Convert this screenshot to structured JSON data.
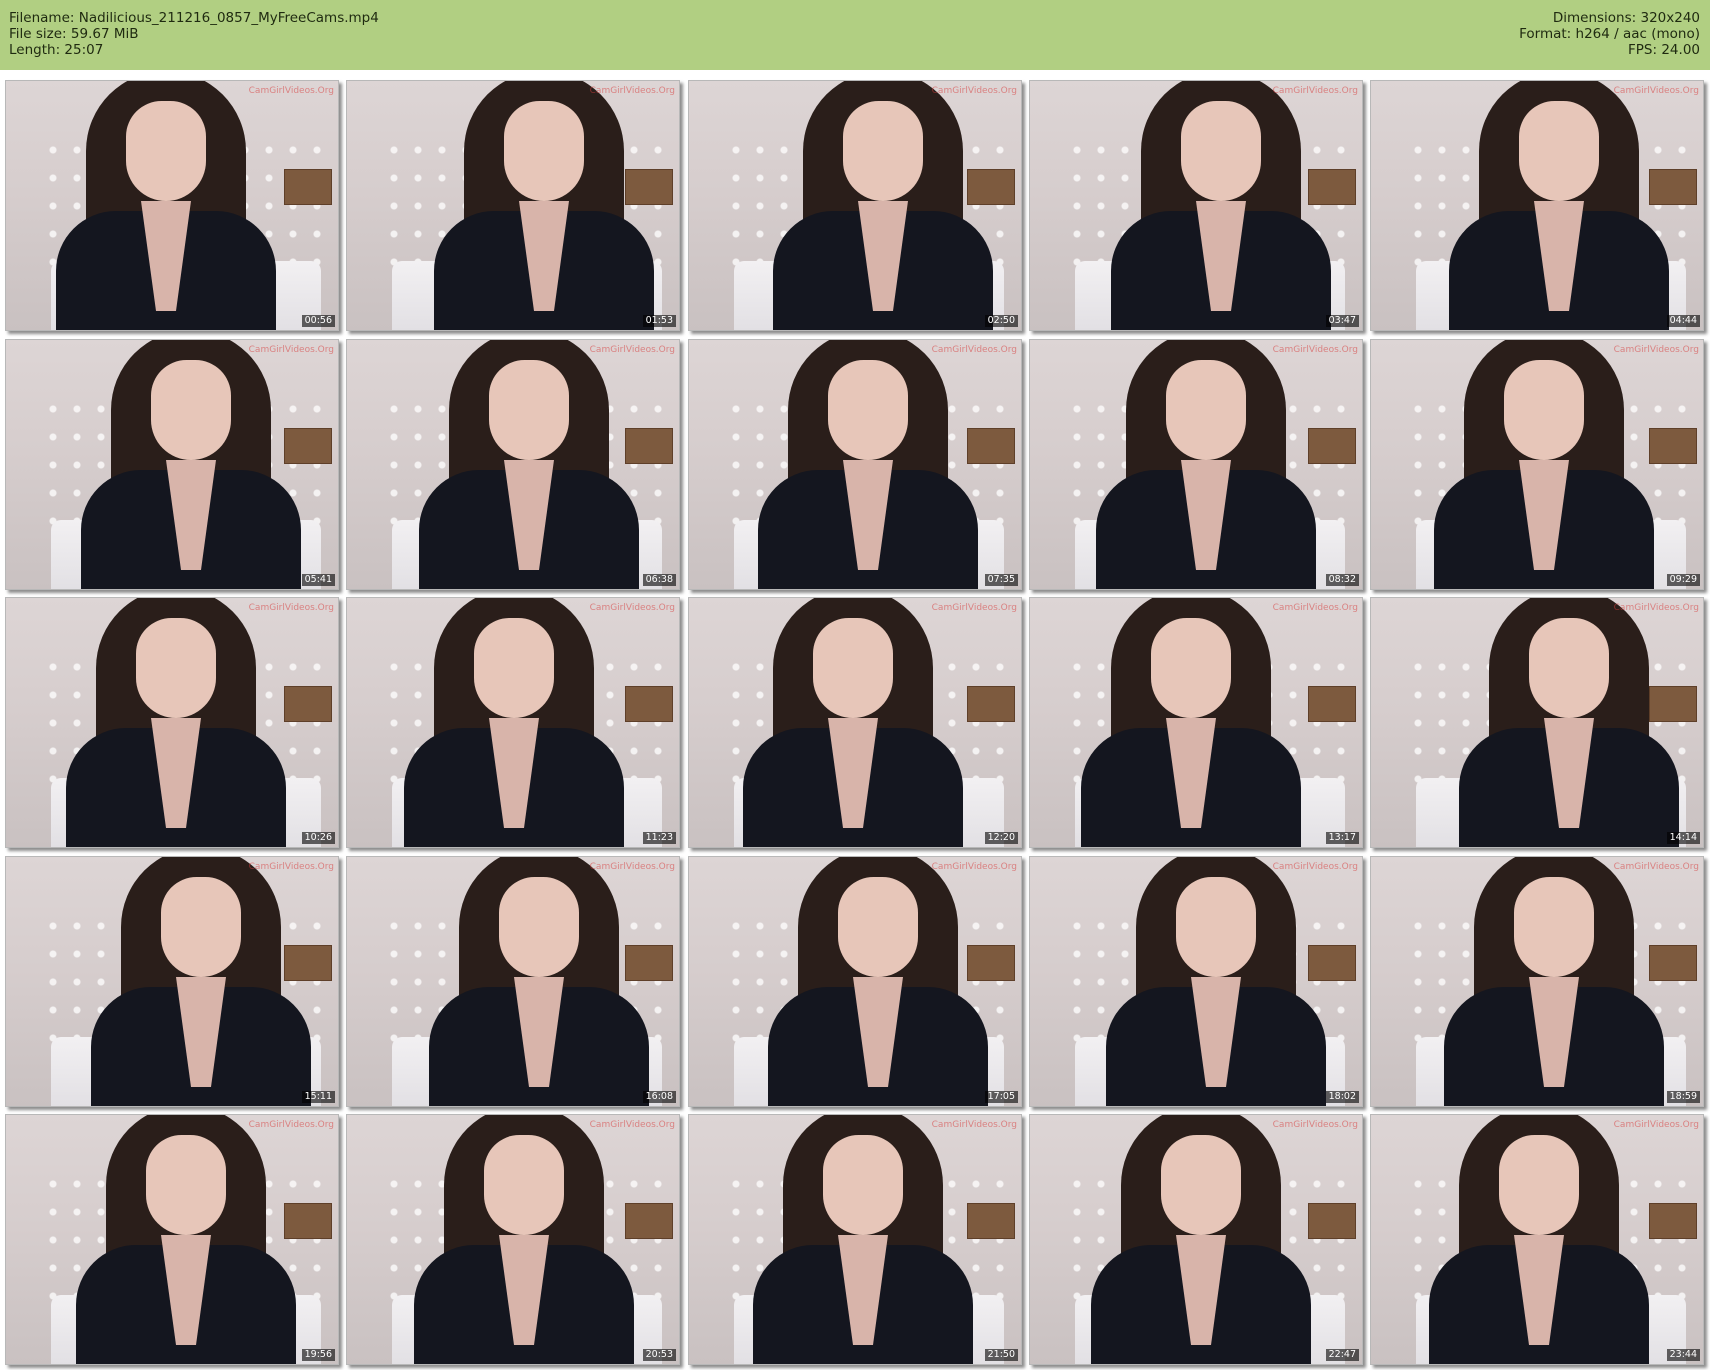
{
  "header": {
    "filename_line": "Filename: Nadilicious_211216_0857_MyFreeCams.mp4",
    "filesize_line": "File size: 59.67 MiB",
    "length_line": "Length: 25:07",
    "dimensions_line": "Dimensions: 320x240",
    "format_line": "Format: h264 / aac (mono)",
    "fps_line": "FPS: 24.00",
    "background_color": "#b1cf82"
  },
  "thumbnails": {
    "columns": 5,
    "rows": 5,
    "watermark": "CamGirlVideos.Org",
    "timestamps": [
      "00:56",
      "01:53",
      "02:50",
      "03:47",
      "04:44",
      "05:41",
      "06:38",
      "07:35",
      "08:32",
      "09:29",
      "10:26",
      "11:23",
      "12:20",
      "13:17",
      "14:14",
      "15:11",
      "16:08",
      "17:05",
      "18:02",
      "18:59",
      "19:56",
      "20:53",
      "21:50",
      "22:47",
      "23:44"
    ]
  }
}
